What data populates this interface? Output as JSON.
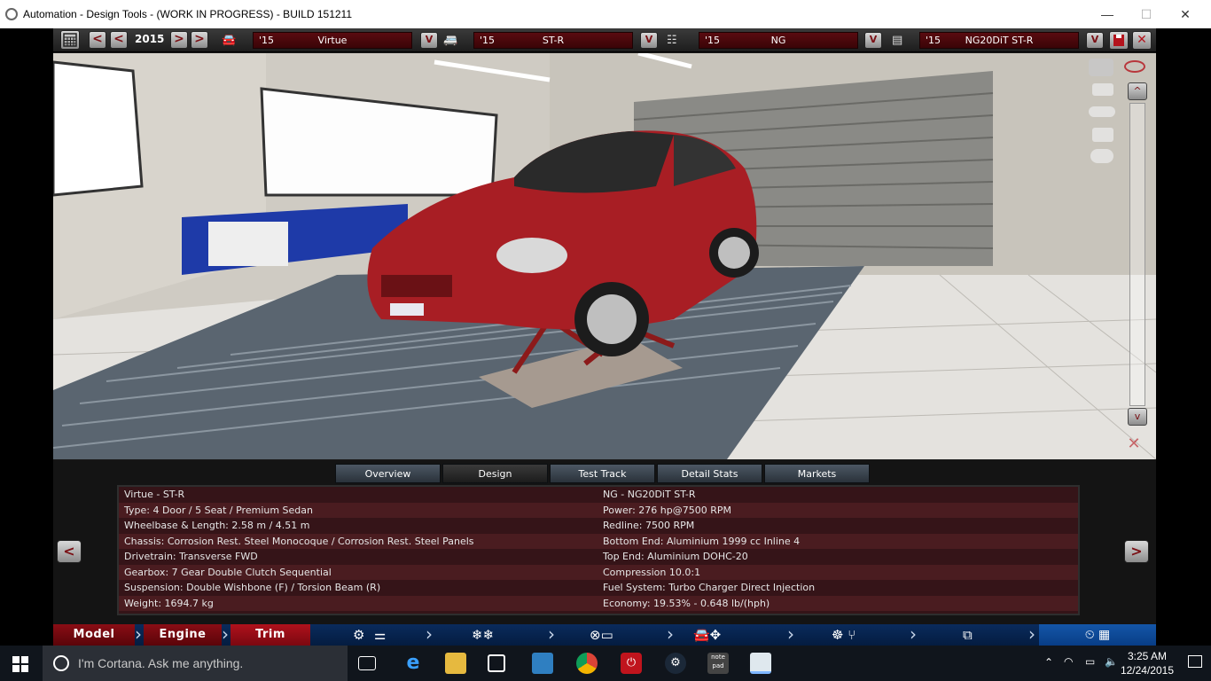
{
  "window": {
    "title": "Automation - Design Tools - (WORK IN PROGRESS) - BUILD 151211",
    "min": "—",
    "max": "☐",
    "close": "✕"
  },
  "topbar": {
    "year": "2015",
    "prev1": "<",
    "prev2": "<",
    "next1": ">",
    "next2": ">",
    "model": {
      "year": "'15",
      "name": "Virtue"
    },
    "trim": {
      "year": "'15",
      "name": "ST-R"
    },
    "engine_family": {
      "year": "'15",
      "name": "NG"
    },
    "engine_variant": {
      "year": "'15",
      "name": "NG20DiT ST-R"
    },
    "dropdown": "V",
    "save_icon": "save-icon",
    "close_icon": "close-icon"
  },
  "viewport": {
    "side_up": "^",
    "side_down": "v"
  },
  "tabs": [
    "Overview",
    "Design",
    "Test Track",
    "Detail Stats",
    "Markets"
  ],
  "active_tab": "Design",
  "info": {
    "left": [
      "Virtue - ST-R",
      "Type: 4 Door / 5 Seat / Premium Sedan",
      "Wheelbase & Length: 2.58 m / 4.51 m",
      "Chassis: Corrosion Rest. Steel Monocoque / Corrosion Rest. Steel Panels",
      "Drivetrain: Transverse FWD",
      "Gearbox: 7 Gear Double Clutch Sequential",
      "Suspension: Double Wishbone (F) / Torsion Beam (R)",
      "Weight: 1694.7 kg"
    ],
    "right": [
      "NG - NG20DiT ST-R",
      "Power: 276 hp@7500 RPM",
      "Redline: 7500 RPM",
      "Bottom End: Aluminium 1999 cc Inline 4",
      "Top End: Aluminium DOHC-20",
      "Compression 10.0:1",
      "Fuel System: Turbo Charger Direct Injection",
      "Economy: 19.53% - 0.648 lb/(hph)"
    ],
    "prev": "<",
    "next": ">"
  },
  "nav": {
    "model": "Model",
    "engine": "Engine",
    "trim": "Trim"
  },
  "taskbar": {
    "cortana": "I'm Cortana. Ask me anything.",
    "time": "3:25 AM",
    "date": "12/24/2015"
  }
}
